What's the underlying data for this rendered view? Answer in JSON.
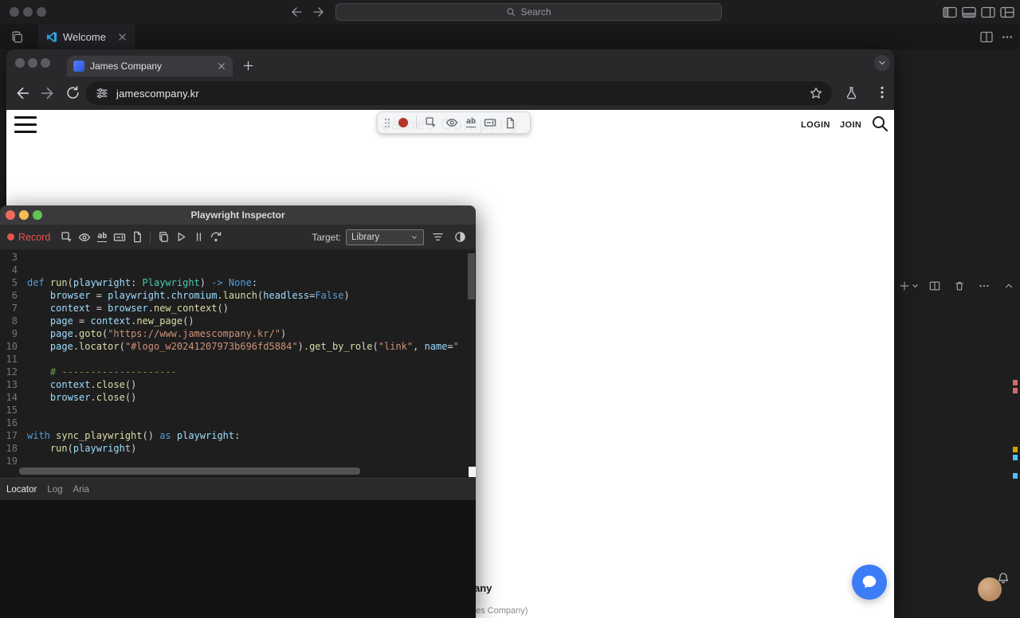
{
  "vscode": {
    "search_placeholder": "Search",
    "welcome_tab_label": "Welcome"
  },
  "chrome": {
    "tab_title": "James Company",
    "url": "jamescompany.kr"
  },
  "site": {
    "brand": "James Company",
    "nav_login": "LOGIN",
    "nav_join": "JOIN",
    "footer_fragment_bold": "any",
    "footer_fragment_muted": "es Company)"
  },
  "inspector": {
    "window_title": "Playwright Inspector",
    "record_label": "Record",
    "target_label": "Target:",
    "target_value": "Library",
    "bottom_tabs": [
      "Locator",
      "Log",
      "Aria"
    ],
    "code_lines": [
      {
        "n": 3,
        "tokens": []
      },
      {
        "n": 4,
        "tokens": []
      },
      {
        "n": 5,
        "tokens": [
          [
            "kw",
            "def "
          ],
          [
            "fn",
            "run"
          ],
          [
            "pl",
            "("
          ],
          [
            "var",
            "playwright"
          ],
          [
            "pl",
            ": "
          ],
          [
            "type",
            "Playwright"
          ],
          [
            "pl",
            ") "
          ],
          [
            "kw",
            "->"
          ],
          [
            "pl",
            " "
          ],
          [
            "kw",
            "None"
          ],
          [
            "pl",
            ":"
          ]
        ]
      },
      {
        "n": 6,
        "tokens": [
          [
            "pl",
            "    "
          ],
          [
            "var",
            "browser"
          ],
          [
            "pl",
            " = "
          ],
          [
            "var",
            "playwright"
          ],
          [
            "pl",
            "."
          ],
          [
            "var",
            "chromium"
          ],
          [
            "pl",
            "."
          ],
          [
            "fn",
            "launch"
          ],
          [
            "pl",
            "("
          ],
          [
            "var",
            "headless"
          ],
          [
            "pl",
            "="
          ],
          [
            "kw",
            "False"
          ],
          [
            "pl",
            ")"
          ]
        ]
      },
      {
        "n": 7,
        "tokens": [
          [
            "pl",
            "    "
          ],
          [
            "var",
            "context"
          ],
          [
            "pl",
            " = "
          ],
          [
            "var",
            "browser"
          ],
          [
            "pl",
            "."
          ],
          [
            "fn",
            "new_context"
          ],
          [
            "pl",
            "()"
          ]
        ]
      },
      {
        "n": 8,
        "tokens": [
          [
            "pl",
            "    "
          ],
          [
            "var",
            "page"
          ],
          [
            "pl",
            " = "
          ],
          [
            "var",
            "context"
          ],
          [
            "pl",
            "."
          ],
          [
            "fn",
            "new_page"
          ],
          [
            "pl",
            "()"
          ]
        ]
      },
      {
        "n": 9,
        "tokens": [
          [
            "pl",
            "    "
          ],
          [
            "var",
            "page"
          ],
          [
            "pl",
            "."
          ],
          [
            "fn",
            "goto"
          ],
          [
            "pl",
            "("
          ],
          [
            "str",
            "\"https://www.jamescompany.kr/\""
          ],
          [
            "pl",
            ")"
          ]
        ]
      },
      {
        "n": 10,
        "tokens": [
          [
            "pl",
            "    "
          ],
          [
            "var",
            "page"
          ],
          [
            "pl",
            "."
          ],
          [
            "fn",
            "locator"
          ],
          [
            "pl",
            "("
          ],
          [
            "str",
            "\"#logo_w20241207973b696fd5884\""
          ],
          [
            "pl",
            ")."
          ],
          [
            "fn",
            "get_by_role"
          ],
          [
            "pl",
            "("
          ],
          [
            "str",
            "\"link\""
          ],
          [
            "pl",
            ", "
          ],
          [
            "var",
            "name"
          ],
          [
            "pl",
            "="
          ],
          [
            "str",
            "\""
          ]
        ]
      },
      {
        "n": 11,
        "tokens": []
      },
      {
        "n": 12,
        "tokens": [
          [
            "pl",
            "    "
          ],
          [
            "cm",
            "# --------------------"
          ]
        ]
      },
      {
        "n": 13,
        "tokens": [
          [
            "pl",
            "    "
          ],
          [
            "var",
            "context"
          ],
          [
            "pl",
            "."
          ],
          [
            "fn",
            "close"
          ],
          [
            "pl",
            "()"
          ]
        ]
      },
      {
        "n": 14,
        "tokens": [
          [
            "pl",
            "    "
          ],
          [
            "var",
            "browser"
          ],
          [
            "pl",
            "."
          ],
          [
            "fn",
            "close"
          ],
          [
            "pl",
            "()"
          ]
        ]
      },
      {
        "n": 15,
        "tokens": []
      },
      {
        "n": 16,
        "tokens": []
      },
      {
        "n": 17,
        "tokens": [
          [
            "kw",
            "with "
          ],
          [
            "fn",
            "sync_playwright"
          ],
          [
            "pl",
            "() "
          ],
          [
            "kw",
            "as "
          ],
          [
            "var",
            "playwright"
          ],
          [
            "pl",
            ":"
          ]
        ]
      },
      {
        "n": 18,
        "tokens": [
          [
            "pl",
            "    "
          ],
          [
            "fn",
            "run"
          ],
          [
            "pl",
            "("
          ],
          [
            "var",
            "playwright"
          ],
          [
            "pl",
            ")"
          ]
        ]
      },
      {
        "n": 19,
        "tokens": []
      }
    ]
  },
  "colors": {
    "record_red": "#b3362a",
    "inspector_record_red": "#e5534b",
    "chat_blue": "#3b7cf7",
    "code_keyword": "#569cd6",
    "code_function": "#dcdcaa",
    "code_variable": "#9cdcfe",
    "code_type": "#4ec9b0",
    "code_string": "#ce9178",
    "code_comment": "#6a9955"
  },
  "icons": {
    "search-icon": "magnifier",
    "record-icon": "filled-circle",
    "pick-locator-icon": "cursor-in-box",
    "assert-visibility-icon": "eye",
    "assert-text-icon": "ab-underline",
    "assert-value-icon": "value-box",
    "assert-snapshot-icon": "document",
    "copy-icon": "two-rects",
    "resume-icon": "play-triangle",
    "pause-icon": "double-bar",
    "step-over-icon": "arc-arrow-dot",
    "hamburger-icon": "three-bars",
    "chat-icon": "speech-bubble",
    "bell-icon": "bell",
    "trash-icon": "trash-can"
  }
}
